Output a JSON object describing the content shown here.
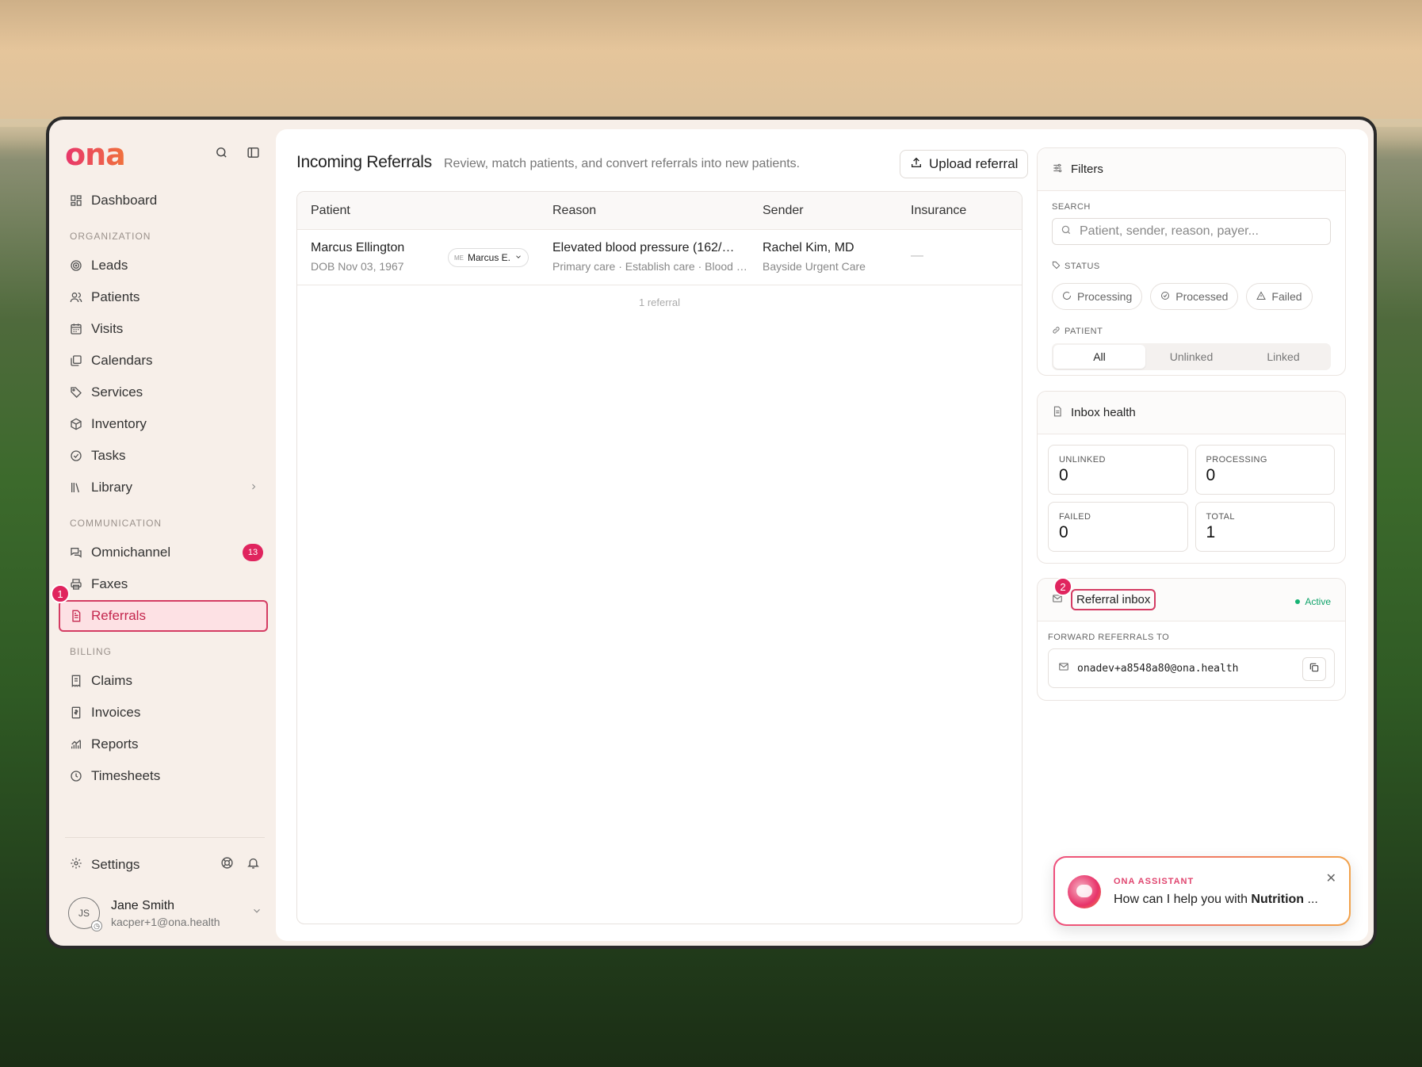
{
  "brand": {
    "logo_text": "ona",
    "accent": "#e0245e"
  },
  "sidebar": {
    "dashboard": "Dashboard",
    "org_label": "ORGANIZATION",
    "org_items": [
      "Leads",
      "Patients",
      "Visits",
      "Calendars",
      "Services",
      "Inventory",
      "Tasks",
      "Library"
    ],
    "comm_label": "COMMUNICATION",
    "omnichannel": "Omnichannel",
    "omnichannel_badge": "13",
    "faxes": "Faxes",
    "referrals": "Referrals",
    "billing_label": "BILLING",
    "billing_items": [
      "Claims",
      "Invoices",
      "Reports",
      "Timesheets"
    ],
    "settings": "Settings",
    "user": {
      "initials": "JS",
      "name": "Jane Smith",
      "email": "kacper+1@ona.health"
    }
  },
  "markers": {
    "m1": "1",
    "m2": "2"
  },
  "main": {
    "title": "Incoming Referrals",
    "subtitle": "Review, match patients, and convert referrals into new patients.",
    "upload_label": "Upload referral",
    "columns": [
      "Patient",
      "Reason",
      "Sender",
      "Insurance"
    ],
    "rows": [
      {
        "patient": "Marcus Ellington",
        "dob": "DOB Nov 03, 1967",
        "match_initials": "ME",
        "match_name": "Marcus E.",
        "reason": "Elevated blood pressure (162/…",
        "reason_sub": "Primary care · Establish care · Blood …",
        "sender": "Rachel Kim, MD",
        "sender_sub": "Bayside Urgent Care",
        "insurance": "—"
      }
    ],
    "footer": "1 referral"
  },
  "filters": {
    "title": "Filters",
    "search_label": "SEARCH",
    "search_placeholder": "Patient, sender, reason, payer...",
    "status_label": "STATUS",
    "status_options": [
      "Processing",
      "Processed",
      "Failed"
    ],
    "patient_label": "PATIENT",
    "patient_options": [
      "All",
      "Unlinked",
      "Linked"
    ]
  },
  "inbox_health": {
    "title": "Inbox health",
    "stats": [
      {
        "label": "UNLINKED",
        "value": "0"
      },
      {
        "label": "PROCESSING",
        "value": "0"
      },
      {
        "label": "FAILED",
        "value": "0"
      },
      {
        "label": "TOTAL",
        "value": "1"
      }
    ]
  },
  "referral_inbox": {
    "title": "Referral inbox",
    "status": "Active",
    "forward_label": "FORWARD REFERRALS TO",
    "email": "onadev+a8548a80@ona.health"
  },
  "assistant": {
    "label": "ONA ASSISTANT",
    "text_prefix": "How can I help you with ",
    "text_bold": "Nutrition",
    "text_suffix": " ..."
  }
}
